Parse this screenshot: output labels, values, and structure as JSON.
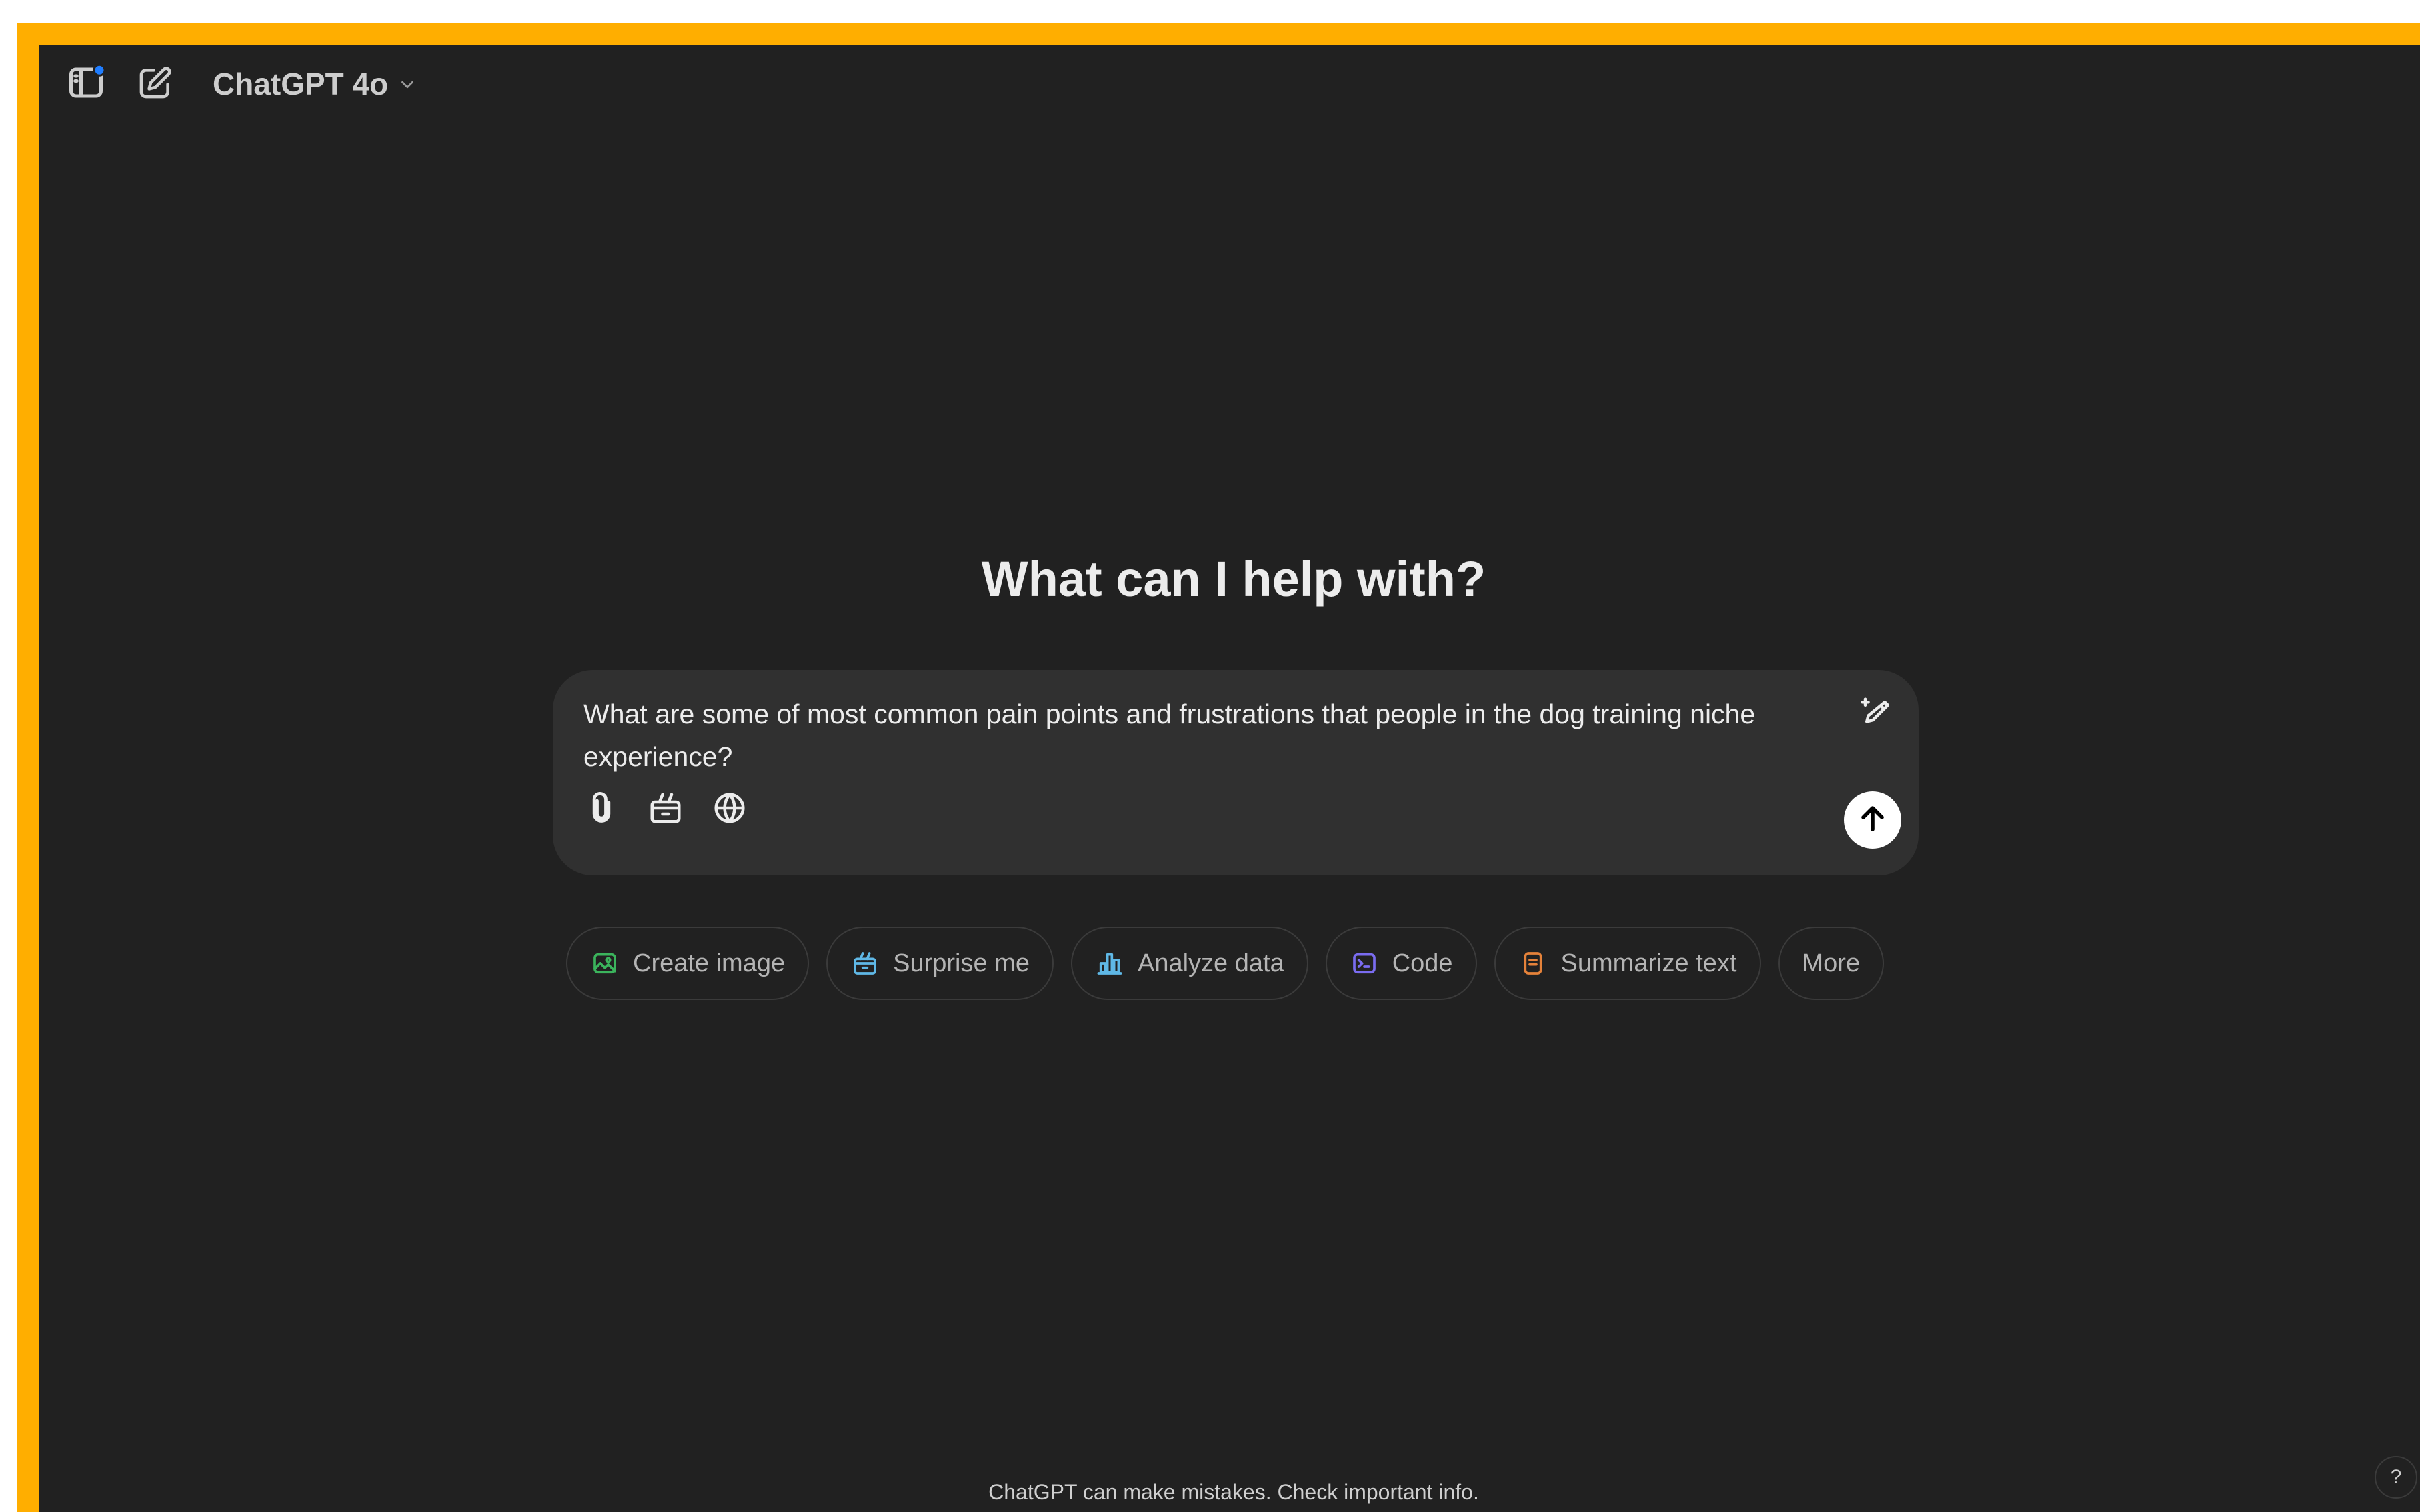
{
  "header": {
    "model_name": "ChatGPT 4o",
    "model_chevron": "⌄",
    "sidebar_icon": "sidebar-toggle-icon",
    "new_chat_icon": "new-chat-icon",
    "notification_dot_color": "#1f7dff"
  },
  "hero": {
    "title": "What can I help with?"
  },
  "composer": {
    "text_line1": "What are some of most common pain points and frustrations that people in the dog training niche",
    "text_line2": "experience?",
    "tools": [
      "attach-icon",
      "tools-icon",
      "globe-icon"
    ],
    "send_icon": "arrow-up-icon"
  },
  "suggestions": [
    {
      "label": "Create image",
      "icon": "image-icon",
      "color": "#3bb45c"
    },
    {
      "label": "Surprise me",
      "icon": "gift-icon",
      "color": "#5fb8e6"
    },
    {
      "label": "Analyze data",
      "icon": "bar-chart-icon",
      "color": "#5fb8e6"
    },
    {
      "label": "Code",
      "icon": "terminal-icon",
      "color": "#7a6cf0"
    },
    {
      "label": "Summarize text",
      "icon": "document-icon",
      "color": "#e5823a"
    },
    {
      "label": "More",
      "icon": "",
      "color": ""
    }
  ],
  "footer": {
    "note": "ChatGPT can make mistakes. Check important info.",
    "help": "?"
  },
  "colors": {
    "frame_border": "#ffae00",
    "background": "#212121",
    "composer_bg": "#303030"
  }
}
